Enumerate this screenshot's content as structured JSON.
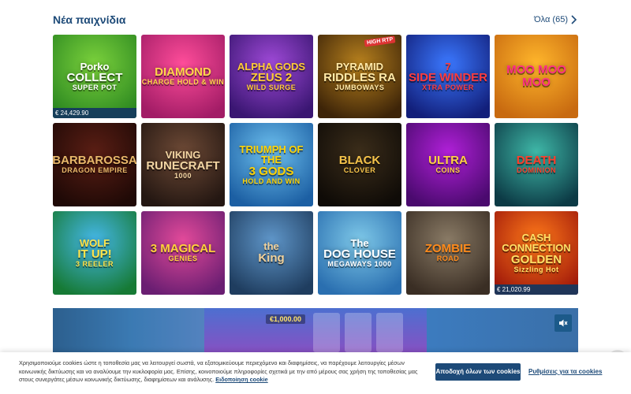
{
  "section": {
    "title": "Νέα παιχνίδια",
    "all_label": "Όλα (65)"
  },
  "games": [
    {
      "lines": [
        "Porko",
        "COLLECT",
        "SUPER POT"
      ],
      "jackpot": "€ 24,429.90",
      "bg": [
        "#7bd13c",
        "#2e8a21"
      ],
      "fg": "#ffffff"
    },
    {
      "lines": [
        "",
        "DIAMOND",
        "CHARGE HOLD & WIN"
      ],
      "jackpot": "",
      "bg": [
        "#ff4d9a",
        "#a21c66"
      ],
      "fg": "#ffd54a"
    },
    {
      "lines": [
        "ALPHA GODS",
        "ZEUS 2",
        "WILD SURGE"
      ],
      "jackpot": "",
      "bg": [
        "#a04ad8",
        "#3a1672"
      ],
      "fg": "#ffcc33"
    },
    {
      "lines": [
        "PYRAMID",
        "RIDDLES RA",
        "JUMBOWAYS"
      ],
      "jackpot": "",
      "bg": [
        "#b9821e",
        "#3d2408"
      ],
      "fg": "#ffe9a8",
      "badge": "HIGH RTP"
    },
    {
      "lines": [
        "7",
        "SIDE WINDER",
        "XTRA POWER"
      ],
      "jackpot": "",
      "bg": [
        "#3b78ff",
        "#121f7a"
      ],
      "fg": "#ff3b3b"
    },
    {
      "lines": [
        "",
        "MOO MOO MOO",
        ""
      ],
      "jackpot": "",
      "bg": [
        "#ffb62b",
        "#c86a10"
      ],
      "fg": "#ff2e86"
    },
    {
      "lines": [
        "",
        "BARBAROSSA",
        "DRAGON EMPIRE"
      ],
      "jackpot": "",
      "bg": [
        "#5a1e14",
        "#1f0906"
      ],
      "fg": "#e8b86a"
    },
    {
      "lines": [
        "VIKING",
        "RUNECRAFT",
        "1000"
      ],
      "jackpot": "",
      "bg": [
        "#6e4a36",
        "#241712"
      ],
      "fg": "#f2d5a3"
    },
    {
      "lines": [
        "TRIUMPH OF THE",
        "3 GODS",
        "HOLD AND WIN"
      ],
      "jackpot": "",
      "bg": [
        "#6ec1ef",
        "#1c5fa3"
      ],
      "fg": "#ffd200"
    },
    {
      "lines": [
        "",
        "BLACK",
        "CLOVER"
      ],
      "jackpot": "",
      "bg": [
        "#3b2d1a",
        "#0f0b07"
      ],
      "fg": "#f5c34a"
    },
    {
      "lines": [
        "",
        "ULTRA",
        "COINS"
      ],
      "jackpot": "",
      "bg": [
        "#b020d8",
        "#4a0a6e"
      ],
      "fg": "#ffd23f"
    },
    {
      "lines": [
        "",
        "DEATH",
        "DOMINION"
      ],
      "jackpot": "",
      "bg": [
        "#3fb8a8",
        "#0c3a45"
      ],
      "fg": "#ff3d2a"
    },
    {
      "lines": [
        "WOLF",
        "IT UP!",
        "3 REELER"
      ],
      "jackpot": "",
      "bg": [
        "#45b7e8",
        "#167a35"
      ],
      "fg": "#ffe34a"
    },
    {
      "lines": [
        "",
        "3 MAGICAL",
        "GENIES"
      ],
      "jackpot": "",
      "bg": [
        "#e34a9a",
        "#6a1e72"
      ],
      "fg": "#ffd23a"
    },
    {
      "lines": [
        "the",
        "King",
        ""
      ],
      "jackpot": "",
      "bg": [
        "#5f96c9",
        "#1f3d5f"
      ],
      "fg": "#f1d19a"
    },
    {
      "lines": [
        "The",
        "DOG HOUSE",
        "MEGAWAYS 1000"
      ],
      "jackpot": "",
      "bg": [
        "#7ec8e8",
        "#2a6fb0"
      ],
      "fg": "#ffffff"
    },
    {
      "lines": [
        "",
        "ZOMBIE",
        "ROAD"
      ],
      "jackpot": "",
      "bg": [
        "#8a7b66",
        "#3a2e24"
      ],
      "fg": "#ff8a1a"
    },
    {
      "lines": [
        "CASH CONNECTION",
        "GOLDEN",
        "Sizzling Hot"
      ],
      "jackpot": "€ 21,020.99",
      "bg": [
        "#ff7a1a",
        "#a11a0a"
      ],
      "fg": "#ffe066"
    }
  ],
  "banner": {
    "win_text": "€1,000.00"
  },
  "cookie": {
    "text": "Χρησιμοποιούμε cookies ώστε η τοποθεσία μας να λειτουργεί σωστά, να εξατομικεύουμε περιεχόμενο και διαφημίσεις, να παρέχουμε λειτουργίες μέσων κοινωνικής δικτύωσης και να αναλύουμε την κυκλοφορία μας. Επίσης, κοινοποιούμε πληροφορίες σχετικά με την από μέρους σας χρήση της τοποθεσίας μας στους συνεργάτες μέσων κοινωνικής δικτύωσης, διαφημίσεων και ανάλυσης.",
    "notice_link": "Ειδοποίηση cookie",
    "accept_label": "Αποδοχή όλων των cookies",
    "settings_label": "Ρυθμίσεις για τα cookies"
  }
}
